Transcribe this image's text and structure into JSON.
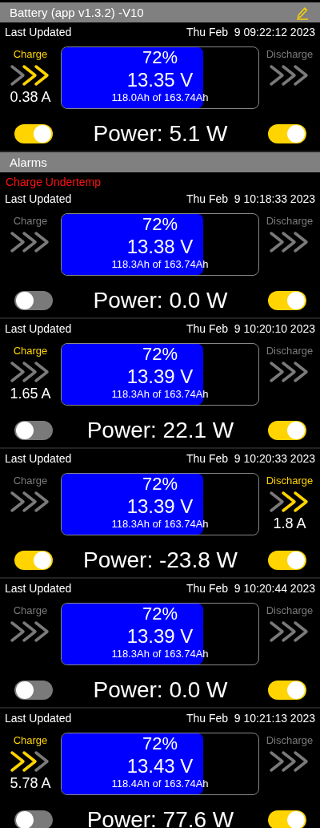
{
  "title_bar": {
    "title": "Battery (app v1.3.2) -V10"
  },
  "current": {
    "updated_label": "Last Updated",
    "timestamp": "Thu Feb  9 09:22:12 2023",
    "charge": {
      "label": "Charge",
      "active": true,
      "chevrons": [
        {
          "lit": false
        },
        {
          "lit": true
        },
        {
          "lit": true
        }
      ],
      "current": "0.38 A"
    },
    "discharge": {
      "label": "Discharge",
      "active": false,
      "chevrons": [
        {
          "lit": false
        },
        {
          "lit": false
        },
        {
          "lit": false
        }
      ]
    },
    "percent": "72%",
    "voltage": "13.35 V",
    "capacity": "118.0Ah of 163.74Ah",
    "level": 0.72,
    "power": "Power: 5.1 W",
    "charge_switch": {
      "on": true
    },
    "discharge_switch": {
      "on": true
    }
  },
  "alarms": {
    "title": "Alarms",
    "message": "Charge Undertemp",
    "history": [
      {
        "updated_label": "Last Updated",
        "timestamp": "Thu Feb  9 10:18:33 2023",
        "charge": {
          "label": "Charge",
          "active": false,
          "chevrons": [
            {
              "lit": false
            },
            {
              "lit": false
            },
            {
              "lit": false
            }
          ]
        },
        "discharge": {
          "label": "Discharge",
          "active": false,
          "chevrons": [
            {
              "lit": false
            },
            {
              "lit": false
            },
            {
              "lit": false
            }
          ]
        },
        "percent": "72%",
        "voltage": "13.38 V",
        "capacity": "118.3Ah of 163.74Ah",
        "level": 0.72,
        "power": "Power: 0.0 W",
        "charge_switch": {
          "on": false
        },
        "discharge_switch": {
          "on": true
        }
      },
      {
        "updated_label": "Last Updated",
        "timestamp": "Thu Feb  9 10:20:10 2023",
        "charge": {
          "label": "Charge",
          "active": true,
          "chevrons": [
            {
              "lit": false
            },
            {
              "lit": false
            },
            {
              "lit": false
            }
          ],
          "current": "1.65 A"
        },
        "discharge": {
          "label": "Discharge",
          "active": false,
          "chevrons": [
            {
              "lit": false
            },
            {
              "lit": false
            },
            {
              "lit": false
            }
          ]
        },
        "percent": "72%",
        "voltage": "13.39 V",
        "capacity": "118.3Ah of 163.74Ah",
        "level": 0.72,
        "power": "Power: 22.1 W",
        "charge_switch": {
          "on": false
        },
        "discharge_switch": {
          "on": true
        }
      },
      {
        "updated_label": "Last Updated",
        "timestamp": "Thu Feb  9 10:20:33 2023",
        "charge": {
          "label": "Charge",
          "active": false,
          "chevrons": [
            {
              "lit": false
            },
            {
              "lit": false
            },
            {
              "lit": false
            }
          ]
        },
        "discharge": {
          "label": "Discharge",
          "active": true,
          "chevrons": [
            {
              "lit": false
            },
            {
              "lit": true
            },
            {
              "lit": true
            }
          ],
          "current": "1.8 A"
        },
        "percent": "72%",
        "voltage": "13.39 V",
        "capacity": "118.3Ah of 163.74Ah",
        "level": 0.72,
        "power": "Power: -23.8 W",
        "charge_switch": {
          "on": true
        },
        "discharge_switch": {
          "on": true
        }
      },
      {
        "updated_label": "Last Updated",
        "timestamp": "Thu Feb  9 10:20:44 2023",
        "charge": {
          "label": "Charge",
          "active": false,
          "chevrons": [
            {
              "lit": false
            },
            {
              "lit": false
            },
            {
              "lit": false
            }
          ]
        },
        "discharge": {
          "label": "Discharge",
          "active": false,
          "chevrons": [
            {
              "lit": false
            },
            {
              "lit": false
            },
            {
              "lit": false
            }
          ]
        },
        "percent": "72%",
        "voltage": "13.39 V",
        "capacity": "118.3Ah of 163.74Ah",
        "level": 0.72,
        "power": "Power: 0.0 W",
        "charge_switch": {
          "on": false
        },
        "discharge_switch": {
          "on": true
        }
      },
      {
        "updated_label": "Last Updated",
        "timestamp": "Thu Feb  9 10:21:13 2023",
        "charge": {
          "label": "Charge",
          "active": true,
          "chevrons": [
            {
              "lit": true
            },
            {
              "lit": true
            },
            {
              "lit": false
            }
          ],
          "current": "5.78 A"
        },
        "discharge": {
          "label": "Discharge",
          "active": false,
          "chevrons": [
            {
              "lit": false
            },
            {
              "lit": false
            },
            {
              "lit": false
            }
          ]
        },
        "percent": "72%",
        "voltage": "13.43 V",
        "capacity": "118.4Ah of 163.74Ah",
        "level": 0.72,
        "power": "Power: 77.6 W",
        "charge_switch": {
          "on": false
        },
        "discharge_switch": {
          "on": true
        }
      }
    ]
  }
}
